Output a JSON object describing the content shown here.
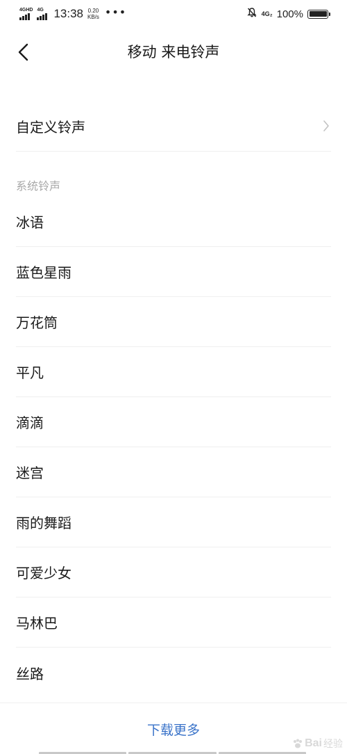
{
  "status_bar": {
    "sim1_label": "4GHD",
    "sim2_label": "4G",
    "time": "13:38",
    "speed_value": "0.20",
    "speed_unit": "KB/s",
    "more_dots": "•••",
    "network2_label": "4G₂",
    "battery_percent": "100%",
    "battery_level": 1.0,
    "icons": [
      "signal-icon",
      "signal-icon",
      "bell-muted-icon",
      "battery-icon"
    ]
  },
  "header": {
    "title": "移动 来电铃声",
    "back_icon": "chevron-left-icon"
  },
  "custom": {
    "label": "自定义铃声",
    "icon": "chevron-right-icon"
  },
  "system_section": {
    "header": "系统铃声",
    "ringtones": [
      "冰语",
      "蓝色星雨",
      "万花筒",
      "平凡",
      "滴滴",
      "迷宫",
      "雨的舞蹈",
      "可爱少女",
      "马林巴",
      "丝路"
    ]
  },
  "footer": {
    "download_more": "下载更多",
    "watermark_text": "Bai",
    "watermark_sub": "经验"
  },
  "colors": {
    "accent": "#3a73c9",
    "text_primary": "#1a1a1a",
    "text_secondary": "#a8a8a8",
    "divider": "#efefef"
  }
}
